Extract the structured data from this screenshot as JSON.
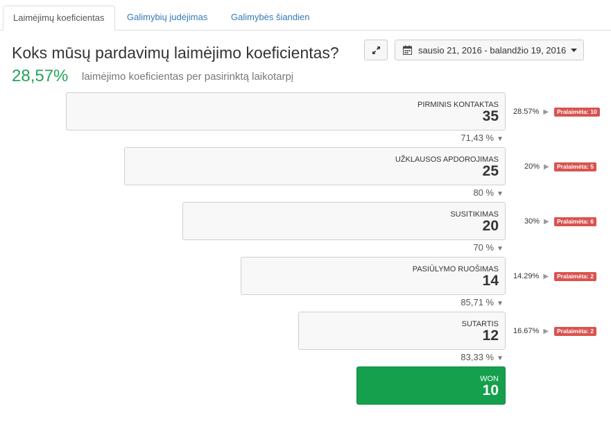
{
  "tabs": [
    {
      "label": "Laimėjimų koeficientas"
    },
    {
      "label": "Galimybių judėjimas"
    },
    {
      "label": "Galimybės šiandien"
    }
  ],
  "header": {
    "title": "Koks mūsų pardavimų laimėjimo koeficientas?",
    "rate_value": "28,57%",
    "rate_description": "laimėjimo koeficientas per pasirinktą laikotarpį",
    "date_range": "sausio 21, 2016 - balandžio 19, 2016"
  },
  "funnel": {
    "stages": [
      {
        "name": "PIRMINIS KONTAKTAS",
        "count": "35",
        "lost_percent": "28.57%",
        "lost_label": "Pralaimėta: 10",
        "next_conversion": "71,43 %"
      },
      {
        "name": "UŽKLAUSOS APDOROJIMAS",
        "count": "25",
        "lost_percent": "20%",
        "lost_label": "Pralaimėta: 5",
        "next_conversion": "80 %"
      },
      {
        "name": "SUSITIKIMAS",
        "count": "20",
        "lost_percent": "30%",
        "lost_label": "Pralaimėta: 6",
        "next_conversion": "70 %"
      },
      {
        "name": "PASIŪLYMO RUOŠIMAS",
        "count": "14",
        "lost_percent": "14.29%",
        "lost_label": "Pralaimėta: 2",
        "next_conversion": "85,71 %"
      },
      {
        "name": "SUTARTIS",
        "count": "12",
        "lost_percent": "16.67%",
        "lost_label": "Pralaimėta: 2",
        "next_conversion": "83,33 %"
      }
    ],
    "won": {
      "name": "WON",
      "count": "10"
    }
  },
  "colors": {
    "accent_green": "#27a25a",
    "won_green": "#15a04e",
    "lost_red": "#d9534f",
    "link_blue": "#337ab7"
  },
  "icons": {
    "expand": "expand-icon",
    "calendar": "calendar-icon",
    "caret": "caret-down-icon"
  }
}
